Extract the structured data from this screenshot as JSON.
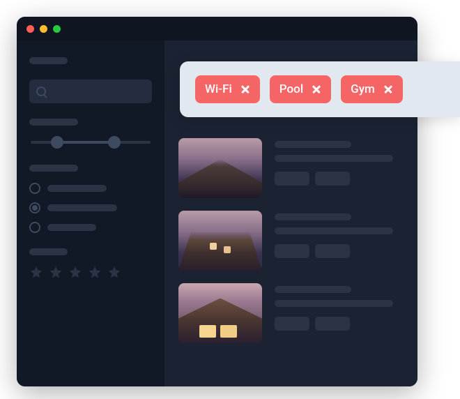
{
  "sidebar": {
    "search_placeholder": "",
    "slider": {
      "min_pos": 22,
      "max_pos": 70
    },
    "radio_selected_index": 1,
    "rating_max": 5
  },
  "filters": {
    "chips": [
      {
        "label": "Wi-Fi"
      },
      {
        "label": "Pool"
      },
      {
        "label": "Gym"
      }
    ]
  },
  "results": {
    "items": [
      {
        "id": 0
      },
      {
        "id": 1
      },
      {
        "id": 2
      }
    ]
  },
  "colors": {
    "chip_bg": "#f56565",
    "filter_bar_bg": "#e2e8f0",
    "window_bg": "#1b2332",
    "sidebar_bg": "#111826"
  }
}
